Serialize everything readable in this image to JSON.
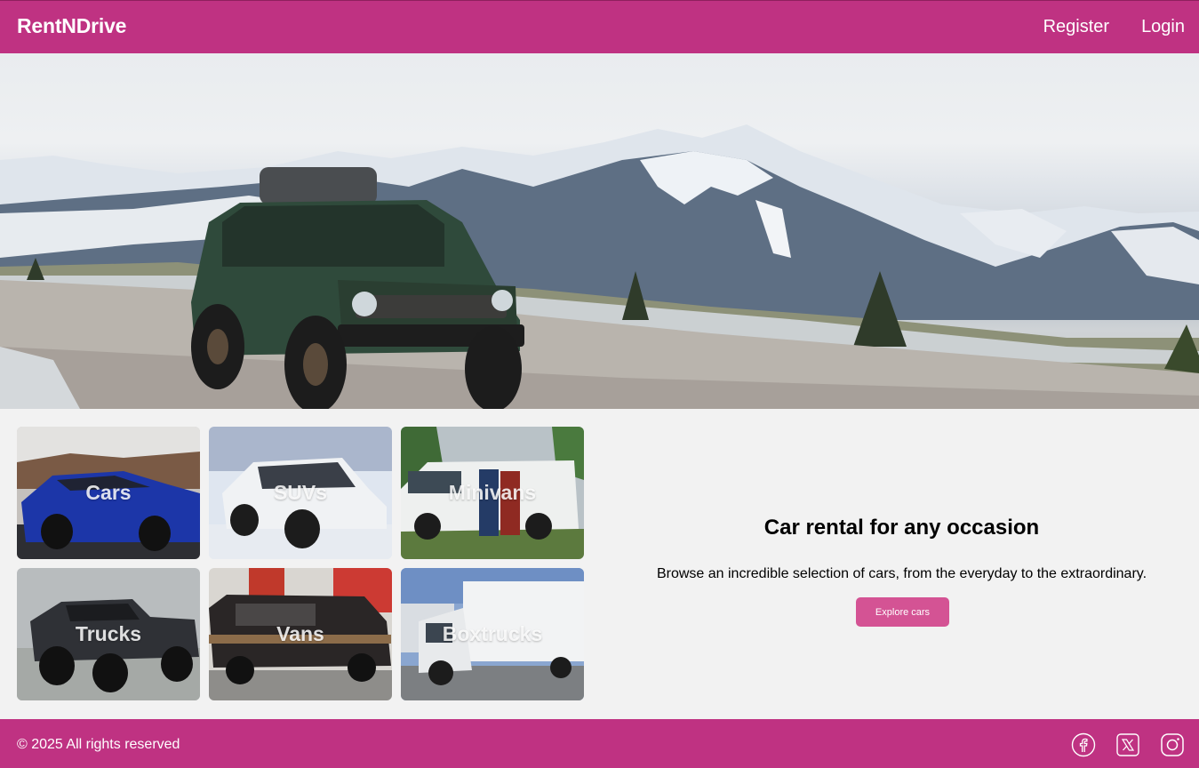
{
  "header": {
    "brand": "RentNDrive",
    "nav": [
      {
        "label": "Register"
      },
      {
        "label": "Login"
      }
    ]
  },
  "categories": [
    {
      "label": "Cars"
    },
    {
      "label": "SUVs"
    },
    {
      "label": "Minivans"
    },
    {
      "label": "Trucks"
    },
    {
      "label": "Vans"
    },
    {
      "label": "Boxtrucks"
    }
  ],
  "promo": {
    "title": "Car rental for any occasion",
    "description": "Browse an incredible selection of cars, from the everyday to the extraordinary.",
    "cta_label": "Explore cars"
  },
  "footer": {
    "copyright": "© 2025 All rights reserved",
    "social_icons": [
      "facebook-icon",
      "x-icon",
      "instagram-icon"
    ]
  },
  "colors": {
    "brand": "#bf3282",
    "button": "#d45394",
    "background": "#f2f2f2"
  }
}
